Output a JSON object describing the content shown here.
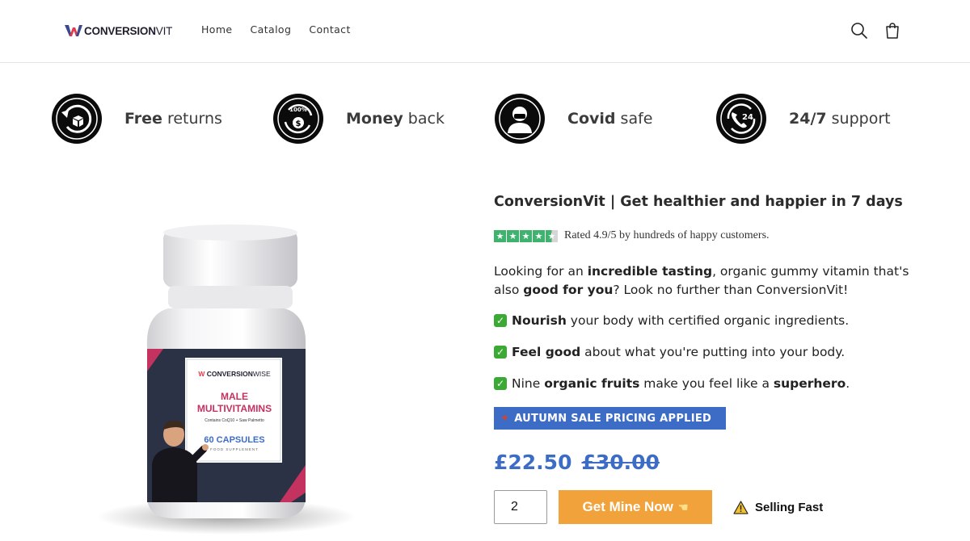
{
  "header": {
    "logo": {
      "brand_bold": "CONVERSION",
      "brand_light": "VIT"
    },
    "nav": [
      "Home",
      "Catalog",
      "Contact"
    ],
    "icons": {
      "search": "search-icon",
      "cart": "cart-icon"
    }
  },
  "features": [
    {
      "bold": "Free",
      "rest": " returns",
      "icon": "return-box-icon"
    },
    {
      "bold": "Money",
      "rest": " back",
      "icon": "money-back-icon"
    },
    {
      "bold": "Covid",
      "rest": " safe",
      "icon": "masked-person-icon"
    },
    {
      "bold": "24/7",
      "rest": " support",
      "icon": "phone-24-icon"
    }
  ],
  "product_image": {
    "label_brand_bold": "CONVERSION",
    "label_brand_light": "WISE",
    "label_line1": "MALE",
    "label_line2": "MULTIVITAMINS",
    "label_sub": "Contains CoQ10 + Saw Palmetto",
    "label_count": "60 CAPSULES",
    "label_foot": "FOOD SUPPLEMENT"
  },
  "product": {
    "title": "ConversionVit | Get healthier and happier in 7 days",
    "rating_text": "Rated 4.9/5 by hundreds of happy customers.",
    "rating_stars": 4.5,
    "desc": {
      "p1": "Looking for an ",
      "b1": "incredible tasting",
      "p2": ", organic gummy vitamin that's also ",
      "b2": "good for you",
      "p3": "? Look no further than ConversionVit!"
    },
    "bullets": [
      {
        "pre": "",
        "bold": "Nourish",
        "post": " your body with certified organic ingredients.",
        "bold2": "",
        "post2": ""
      },
      {
        "pre": "",
        "bold": "Feel good",
        "post": " about what you're putting into your body.",
        "bold2": "",
        "post2": ""
      },
      {
        "pre": "Nine ",
        "bold": "organic fruits",
        "post": " make you feel like a ",
        "bold2": "superhero",
        "post2": "."
      }
    ],
    "sale_banner": "AUTUMN SALE PRICING APPLIED",
    "price": "£22.50",
    "old_price": "£30.00",
    "quantity": "2",
    "buy_label": "Get Mine Now",
    "selling_label": "Selling Fast"
  },
  "colors": {
    "accent_blue": "#3d6cc7",
    "buy_orange": "#f2a23b",
    "star_green": "#3fb36d",
    "brand_red": "#e03d4b"
  }
}
